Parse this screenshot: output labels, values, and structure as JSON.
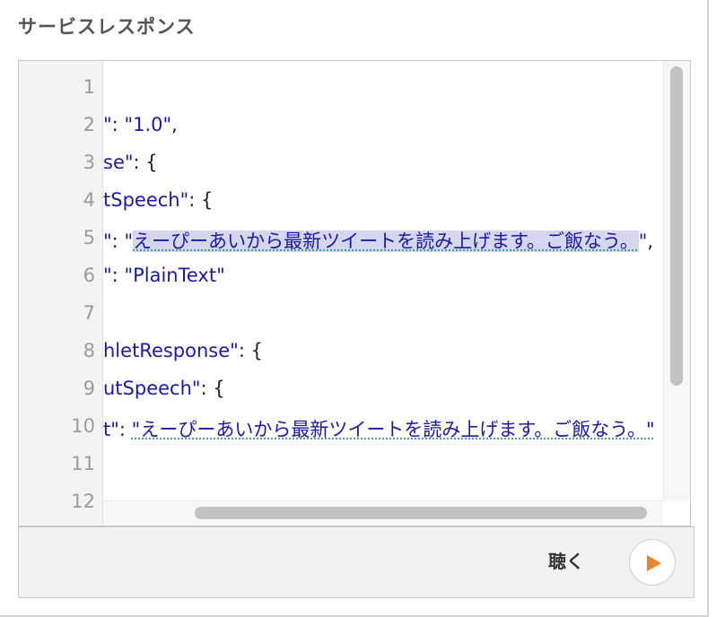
{
  "section": {
    "title": "サービスレスポンス"
  },
  "editor": {
    "line_numbers": [
      "1",
      "2",
      "3",
      "4",
      "5",
      "6",
      "7",
      "8",
      "9",
      "10",
      "11",
      "12"
    ],
    "lines": {
      "l2": {
        "key_tail": "\"",
        "sep": ": ",
        "value": "\"1.0\"",
        "end": ","
      },
      "l3": {
        "key_tail": "se\"",
        "sep": ": ",
        "end": "{"
      },
      "l4": {
        "key_tail": "tSpeech\"",
        "sep": ": ",
        "end": "{"
      },
      "l5": {
        "key_tail": "\"",
        "sep": ": ",
        "value_open": "\"",
        "value": "えーぴーあいから最新ツイートを読み上げます。ご飯なう。",
        "value_close": "\"",
        "end": ","
      },
      "l6": {
        "key_tail": "\"",
        "sep": ": ",
        "value": "\"PlainText\""
      },
      "l8": {
        "key_tail": "hletResponse\"",
        "sep": ": ",
        "end": "{"
      },
      "l9": {
        "key_tail": "utSpeech\"",
        "sep": ": ",
        "end": "{"
      },
      "l10": {
        "key_tail": "t\"",
        "sep": ": ",
        "value": "\"えーぴーあいから最新ツイートを読み上げます。ご飯なう。\""
      }
    }
  },
  "footer": {
    "listen_label": "聴く",
    "play_icon": "play-icon",
    "accent_color": "#e8842a"
  }
}
